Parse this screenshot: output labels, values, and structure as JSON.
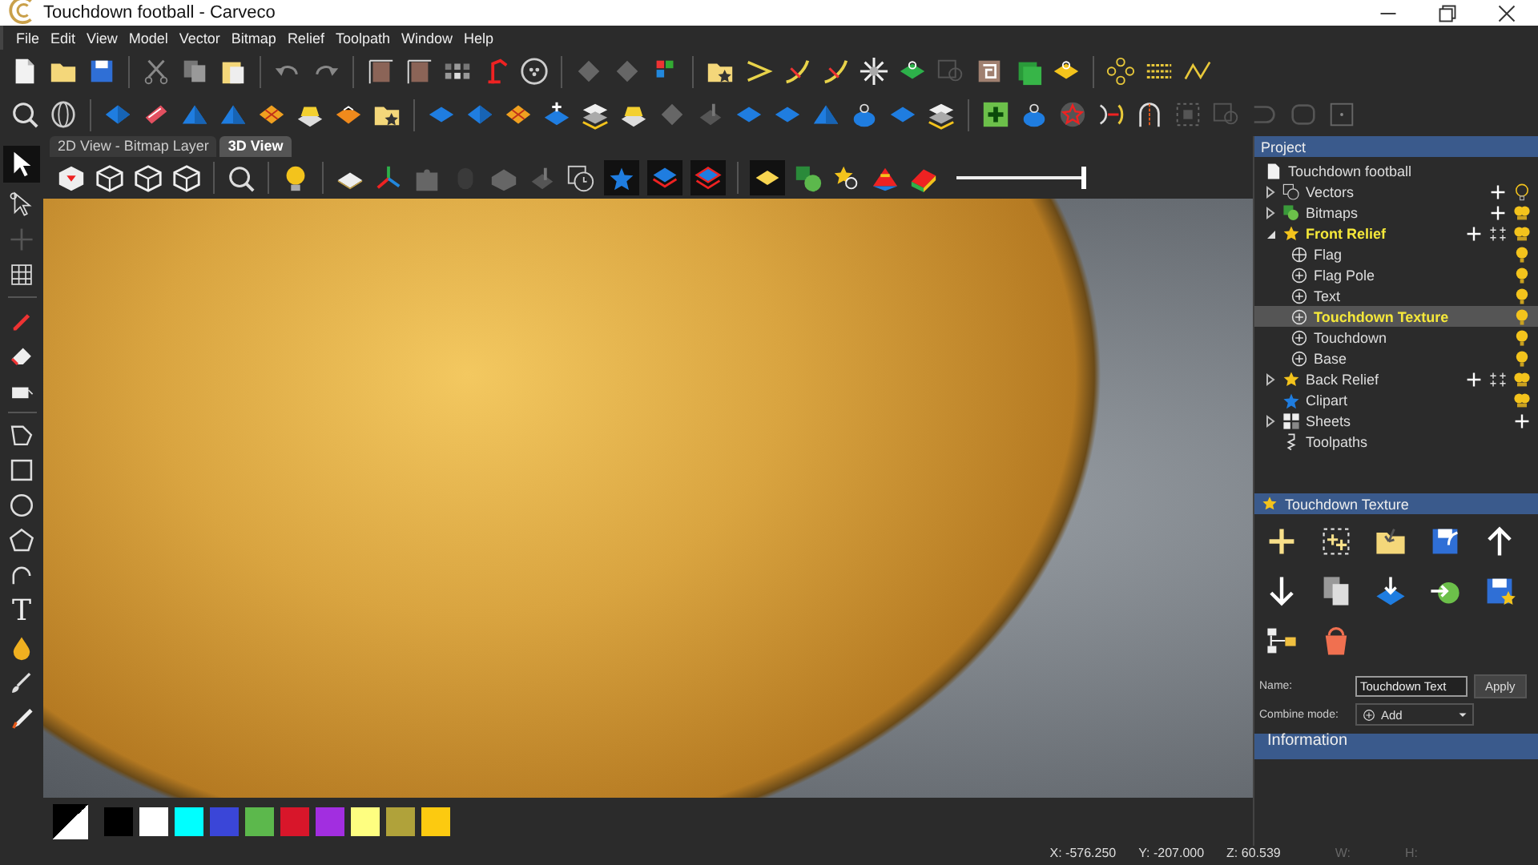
{
  "window": {
    "title": "Touchdown football - Carveco"
  },
  "menu": [
    "File",
    "Edit",
    "View",
    "Model",
    "Vector",
    "Bitmap",
    "Relief",
    "Toolpath",
    "Window",
    "Help"
  ],
  "left_toolbar": {
    "text_tool_glyph": "T"
  },
  "view_tabs": [
    {
      "label": "2D View - Bitmap Layer",
      "selected": false
    },
    {
      "label": "3D View",
      "selected": true
    }
  ],
  "view_toolbar": {
    "slider": {
      "level": 1.0
    }
  },
  "project": {
    "title": "Project",
    "root": "Touchdown football",
    "tree": [
      {
        "label": "Vectors",
        "kind": "vectors",
        "selected": false,
        "active": false,
        "visible": false
      },
      {
        "label": "Bitmaps",
        "kind": "bitmaps",
        "selected": false,
        "active": false,
        "visible": true
      },
      {
        "label": "Front Relief",
        "kind": "relief",
        "selected": false,
        "active": true,
        "visible": true,
        "children": [
          {
            "label": "Flag",
            "kind": "flag-layer",
            "selected": false,
            "active": false,
            "visible": true
          },
          {
            "label": "Flag Pole",
            "kind": "layer",
            "selected": false,
            "active": false,
            "visible": true
          },
          {
            "label": "Text",
            "kind": "layer",
            "selected": false,
            "active": false,
            "visible": true
          },
          {
            "label": "Touchdown Texture",
            "kind": "layer",
            "selected": true,
            "active": true,
            "visible": true
          },
          {
            "label": "Touchdown",
            "kind": "layer",
            "selected": false,
            "active": false,
            "visible": true
          },
          {
            "label": "Base",
            "kind": "layer",
            "selected": false,
            "active": false,
            "visible": true
          }
        ]
      },
      {
        "label": "Back Relief",
        "kind": "relief",
        "selected": false,
        "active": false,
        "visible": true
      },
      {
        "label": "Clipart",
        "kind": "clipart",
        "selected": false,
        "active": false,
        "visible": true
      },
      {
        "label": "Sheets",
        "kind": "sheets",
        "selected": false,
        "active": false
      },
      {
        "label": "Toolpaths",
        "kind": "toolpaths",
        "selected": false,
        "active": false
      }
    ]
  },
  "layer_panel": {
    "title": "Touchdown Texture",
    "name": {
      "label": "Name:",
      "value": "Touchdown Text"
    },
    "apply": "Apply",
    "combine_mode": {
      "label": "Combine mode:",
      "value": "Add"
    }
  },
  "information": {
    "title": "Information"
  },
  "palette": [
    {
      "color": "#000000"
    },
    {
      "color": "#ffffff"
    },
    {
      "color": "#00ffff"
    },
    {
      "color": "#3a46d8"
    },
    {
      "color": "#5cb84c"
    },
    {
      "color": "#d8162a"
    },
    {
      "color": "#a22ee0"
    },
    {
      "color": "#fefe80"
    },
    {
      "color": "#b0a23a"
    },
    {
      "color": "#fcca10"
    }
  ],
  "status_bar": [
    {
      "text": "X: -576.250",
      "dim": false
    },
    {
      "text": "Y: -207.000",
      "dim": false
    },
    {
      "text": "Z: 60.539",
      "dim": false
    },
    {
      "text": "W:",
      "dim": true
    },
    {
      "text": "H:",
      "dim": true
    }
  ]
}
